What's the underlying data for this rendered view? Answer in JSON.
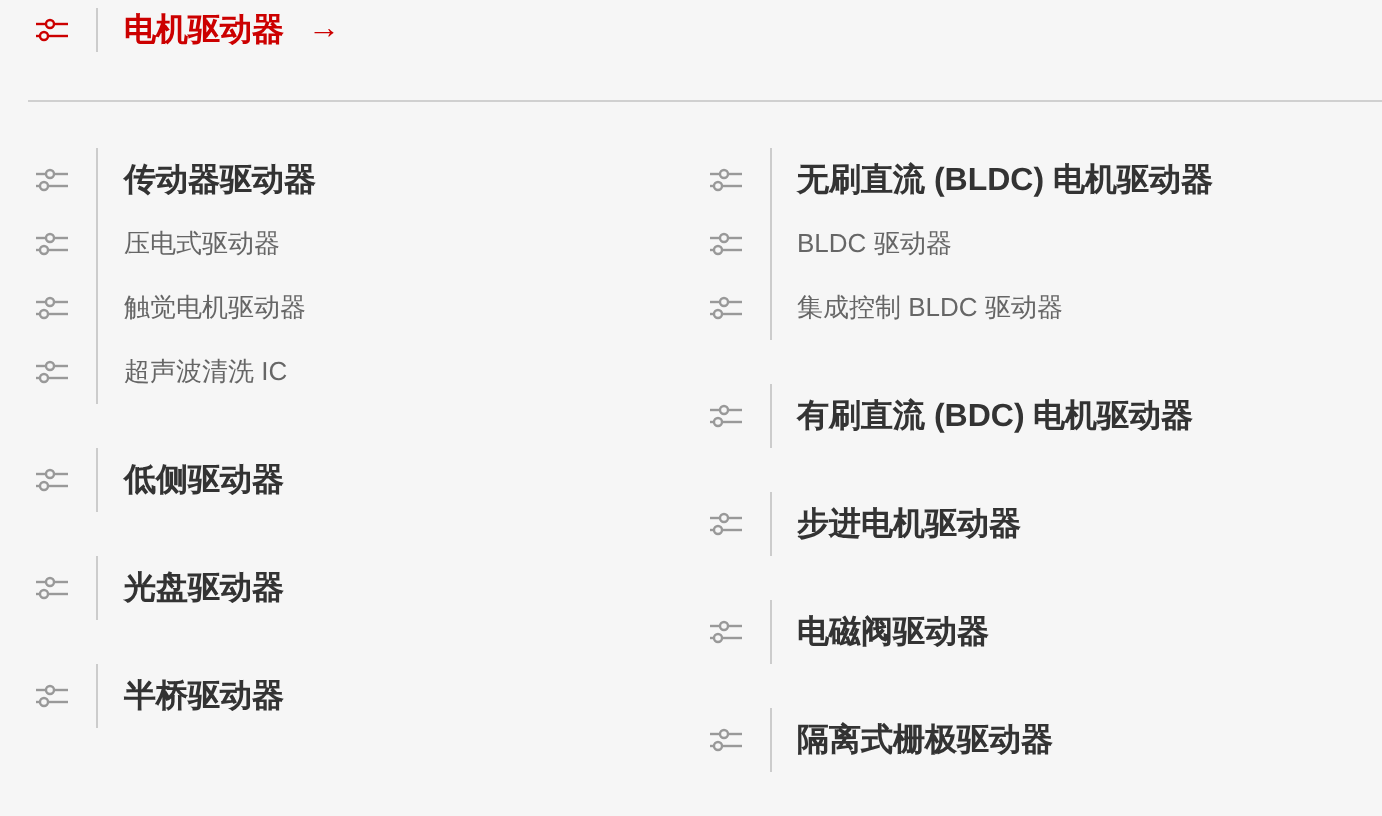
{
  "header": {
    "title": "电机驱动器",
    "arrow": "→"
  },
  "columns": [
    {
      "groups": [
        {
          "title": "传动器驱动器",
          "children": [
            "压电式驱动器",
            "触觉电机驱动器",
            "超声波清洗 IC"
          ]
        },
        {
          "title": "低侧驱动器"
        },
        {
          "title": "光盘驱动器"
        },
        {
          "title": "半桥驱动器"
        }
      ]
    },
    {
      "groups": [
        {
          "title": "无刷直流 (BLDC) 电机驱动器",
          "children": [
            "BLDC 驱动器",
            "集成控制 BLDC 驱动器"
          ]
        },
        {
          "title": "有刷直流 (BDC) 电机驱动器"
        },
        {
          "title": "步进电机驱动器"
        },
        {
          "title": "电磁阀驱动器"
        },
        {
          "title": "隔离式栅极驱动器"
        }
      ]
    }
  ]
}
